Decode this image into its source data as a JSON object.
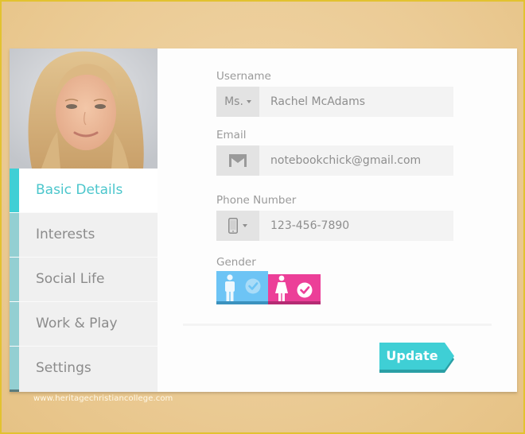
{
  "profile": {
    "photo_alt": "Profile photo of a smiling woman with long blonde hair"
  },
  "sidebar": {
    "items": [
      {
        "label": "Basic Details",
        "active": true
      },
      {
        "label": "Interests",
        "active": false
      },
      {
        "label": "Social Life",
        "active": false
      },
      {
        "label": "Work & Play",
        "active": false
      },
      {
        "label": "Settings",
        "active": false
      }
    ]
  },
  "form": {
    "username": {
      "label": "Username",
      "title_select": "Ms.",
      "value": "Rachel McAdams"
    },
    "email": {
      "label": "Email",
      "icon": "gmail-icon",
      "value": "notebookchick@gmail.com"
    },
    "phone": {
      "label": "Phone Number",
      "icon": "mobile-phone-icon",
      "value": "123-456-7890"
    },
    "gender": {
      "label": "Gender",
      "options": [
        {
          "name": "male",
          "icon": "male-icon",
          "selected": false
        },
        {
          "name": "female",
          "icon": "female-icon",
          "selected": true
        }
      ]
    },
    "update_label": "Update"
  },
  "watermark": "www.heritagechristiancollege.com",
  "colors": {
    "accent": "#3fcfd5",
    "male": "#6dc4f5",
    "female": "#ec3f98",
    "frame": "#e2c230"
  }
}
